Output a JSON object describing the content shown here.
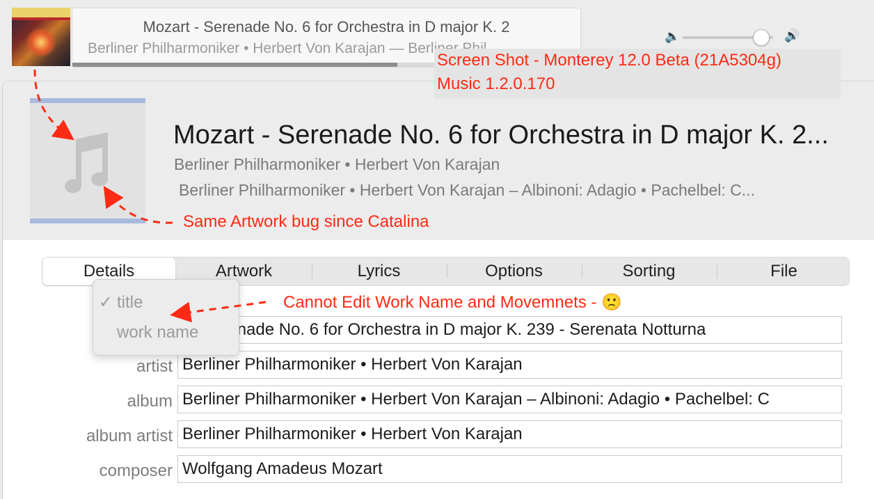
{
  "mini_player": {
    "title": "Mozart - Serenade No. 6 for Orchestra in D major K. 2",
    "subtitle": "Berliner Philharmoniker • Herbert Von Karajan — Berliner Phil",
    "progress": 0.64,
    "volume": 0.86,
    "icons": [
      "volume-low-icon",
      "volume-high-icon"
    ]
  },
  "screenshot_note": {
    "line1": "Screen Shot - Monterey 12.0 Beta (21A5304g)",
    "line2": "Music 1.2.0.170",
    "color": "#ff2a14"
  },
  "header": {
    "title": "Mozart - Serenade No. 6 for Orchestra in D major K. 2...",
    "artist": "Berliner Philharmoniker • Herbert Von Karajan",
    "album": "Berliner Philharmoniker • Herbert Von Karajan – Albinoni: Adagio • Pachelbel: C...",
    "artwork_icon": "music-note-icon"
  },
  "annotations": {
    "artwork_bug": "Same Artwork bug since Catalina",
    "work_name": "Cannot Edit Work Name and Movemnets - 🙁"
  },
  "tabs": [
    "Details",
    "Artwork",
    "Lyrics",
    "Options",
    "Sorting",
    "File"
  ],
  "selected_tab": "Details",
  "title_popup": {
    "items": [
      {
        "label": "title",
        "checked": true
      },
      {
        "label": "work name",
        "checked": false
      }
    ],
    "checkmark": "✓"
  },
  "fields": [
    {
      "label": "",
      "value": "t - Serenade No. 6 for Orchestra in D major K. 239 - Serenata Notturna"
    },
    {
      "label": "artist",
      "value": "Berliner Philharmoniker • Herbert Von Karajan"
    },
    {
      "label": "album",
      "value": " Berliner Philharmoniker • Herbert Von Karajan – Albinoni: Adagio • Pachelbel: C"
    },
    {
      "label": "album artist",
      "value": "Berliner Philharmoniker • Herbert Von Karajan"
    },
    {
      "label": "composer",
      "value": "Wolfgang Amadeus Mozart"
    }
  ]
}
